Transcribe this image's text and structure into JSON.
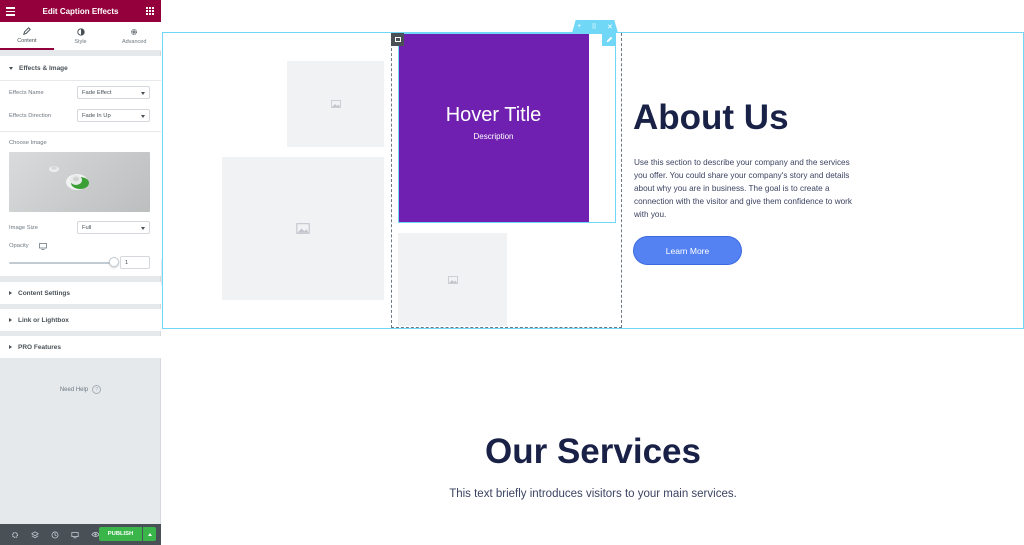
{
  "panel": {
    "header_title": "Edit Caption Effects",
    "tabs": [
      {
        "label": "Content",
        "icon": "pencil-icon",
        "active": true
      },
      {
        "label": "Style",
        "icon": "half-circle-icon",
        "active": false
      },
      {
        "label": "Advanced",
        "icon": "gear-icon",
        "active": false
      }
    ],
    "effects_section": {
      "title": "Effects & Image",
      "effects_name_label": "Effects Name",
      "effects_name_value": "Fade Effect",
      "effects_direction_label": "Effects Direction",
      "effects_direction_value": "Fade In Up",
      "choose_image_label": "Choose Image",
      "image_size_label": "Image Size",
      "image_size_value": "Full",
      "opacity_label": "Opacity",
      "opacity_value": "1"
    },
    "collapsed_sections": [
      "Content Settings",
      "Link or Lightbox",
      "PRO Features"
    ],
    "need_help": "Need Help",
    "publish_label": "PUBLISH",
    "accent_color": "#93003c",
    "publish_color": "#39b54a"
  },
  "canvas": {
    "hover_card": {
      "title": "Hover Title",
      "description": "Description",
      "color": "#7020b0"
    },
    "about": {
      "title": "About Us",
      "text": "Use this section to describe your company and the services you offer. You could share your company's story and details about why you are in business. The goal is to create a connection with the visitor and give them confidence to work with you.",
      "button_label": "Learn More",
      "button_color": "#5582f2"
    },
    "services": {
      "title": "Our Services",
      "text": "This text briefly introduces visitors to your main services."
    },
    "selection_color": "#71d7f7"
  }
}
